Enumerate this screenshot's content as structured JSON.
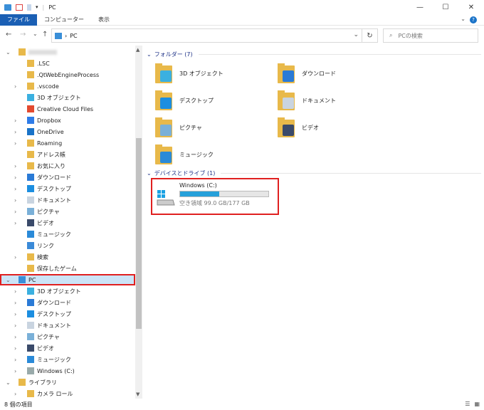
{
  "window": {
    "title": "PC",
    "minimize": "—",
    "maximize": "☐",
    "close": "✕"
  },
  "ribbon": {
    "tabs": [
      "ファイル",
      "コンピューター",
      "表示"
    ],
    "help": "?",
    "collapse": "⌄"
  },
  "nav": {
    "back": "←",
    "forward": "→",
    "recent": "⌄",
    "up": "↑",
    "path": "PC",
    "separator": "›",
    "dropdown": "⌄",
    "refresh": "↻",
    "search_placeholder": "PCの検索"
  },
  "tree": [
    {
      "label": "",
      "indent": 0,
      "exp": "⌄",
      "icon": "user",
      "blurred": true
    },
    {
      "label": ".LSC",
      "indent": 1,
      "exp": "",
      "icon": "folder"
    },
    {
      "label": ".QtWebEngineProcess",
      "indent": 1,
      "exp": "",
      "icon": "folder"
    },
    {
      "label": ".vscode",
      "indent": 1,
      "exp": "›",
      "icon": "folder"
    },
    {
      "label": "3D オブジェクト",
      "indent": 1,
      "exp": "",
      "icon": "3d"
    },
    {
      "label": "Creative Cloud Files",
      "indent": 1,
      "exp": "",
      "icon": "cc"
    },
    {
      "label": "Dropbox",
      "indent": 1,
      "exp": "›",
      "icon": "dropbox"
    },
    {
      "label": "OneDrive",
      "indent": 1,
      "exp": "›",
      "icon": "onedrive"
    },
    {
      "label": "Roaming",
      "indent": 1,
      "exp": "›",
      "icon": "folder"
    },
    {
      "label": "アドレス帳",
      "indent": 1,
      "exp": "",
      "icon": "contacts"
    },
    {
      "label": "お気に入り",
      "indent": 1,
      "exp": "›",
      "icon": "favorites"
    },
    {
      "label": "ダウンロード",
      "indent": 1,
      "exp": "›",
      "icon": "download"
    },
    {
      "label": "デスクトップ",
      "indent": 1,
      "exp": "›",
      "icon": "desktop"
    },
    {
      "label": "ドキュメント",
      "indent": 1,
      "exp": "›",
      "icon": "document"
    },
    {
      "label": "ピクチャ",
      "indent": 1,
      "exp": "›",
      "icon": "picture"
    },
    {
      "label": "ビデオ",
      "indent": 1,
      "exp": "›",
      "icon": "video"
    },
    {
      "label": "ミュージック",
      "indent": 1,
      "exp": "",
      "icon": "music"
    },
    {
      "label": "リンク",
      "indent": 1,
      "exp": "",
      "icon": "links"
    },
    {
      "label": "検索",
      "indent": 1,
      "exp": "›",
      "icon": "search"
    },
    {
      "label": "保存したゲーム",
      "indent": 1,
      "exp": "",
      "icon": "games"
    },
    {
      "label": "PC",
      "indent": 0,
      "exp": "⌄",
      "icon": "pc",
      "selected": true
    },
    {
      "label": "3D オブジェクト",
      "indent": 1,
      "exp": "›",
      "icon": "3d"
    },
    {
      "label": "ダウンロード",
      "indent": 1,
      "exp": "›",
      "icon": "download"
    },
    {
      "label": "デスクトップ",
      "indent": 1,
      "exp": "›",
      "icon": "desktop"
    },
    {
      "label": "ドキュメント",
      "indent": 1,
      "exp": "›",
      "icon": "document"
    },
    {
      "label": "ピクチャ",
      "indent": 1,
      "exp": "›",
      "icon": "picture"
    },
    {
      "label": "ビデオ",
      "indent": 1,
      "exp": "›",
      "icon": "video"
    },
    {
      "label": "ミュージック",
      "indent": 1,
      "exp": "›",
      "icon": "music"
    },
    {
      "label": "Windows (C:)",
      "indent": 1,
      "exp": "›",
      "icon": "drive"
    },
    {
      "label": "ライブラリ",
      "indent": 0,
      "exp": "⌄",
      "icon": "library"
    },
    {
      "label": "カメラ ロール",
      "indent": 1,
      "exp": "›",
      "icon": "folder"
    }
  ],
  "content": {
    "folders_header": "フォルダー (7)",
    "folders": [
      {
        "label": "3D オブジェクト",
        "icon": "3d"
      },
      {
        "label": "ダウンロード",
        "icon": "download"
      },
      {
        "label": "デスクトップ",
        "icon": "desktop"
      },
      {
        "label": "ドキュメント",
        "icon": "document"
      },
      {
        "label": "ピクチャ",
        "icon": "picture"
      },
      {
        "label": "ビデオ",
        "icon": "video"
      },
      {
        "label": "ミュージック",
        "icon": "music"
      }
    ],
    "devices_header": "デバイスとドライブ (1)",
    "drive": {
      "name": "Windows (C:)",
      "free_text": "空き領域 99.0 GB/177 GB",
      "used_percent": 44
    }
  },
  "status": {
    "items": "8 個の項目"
  },
  "colors": {
    "accent": "#1a5fb4",
    "selection": "#cce4f7",
    "highlight_border": "#e02020",
    "drive_bar": "#26a0da"
  }
}
